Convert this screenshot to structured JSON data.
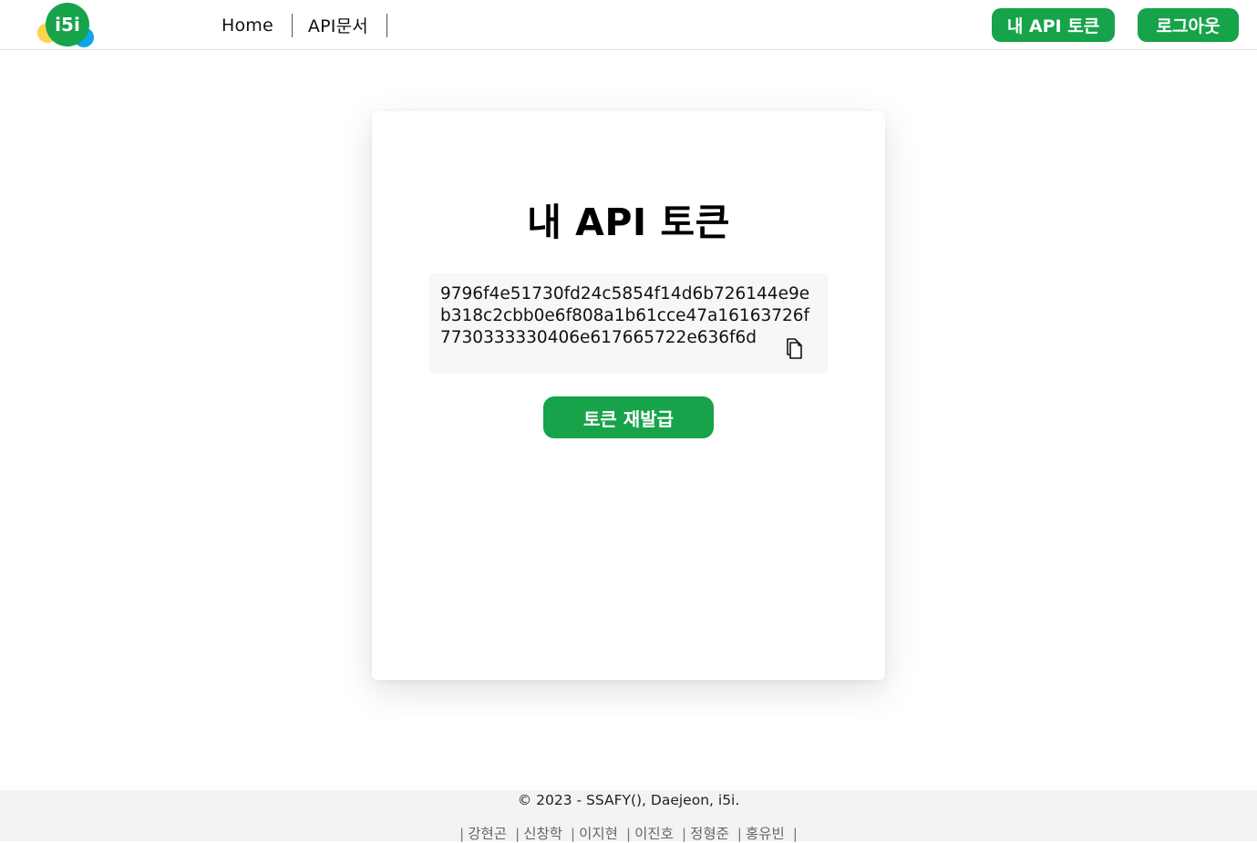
{
  "header": {
    "logo_text": "i5i",
    "nav": [
      {
        "label": "Home"
      },
      {
        "label": "API문서"
      }
    ],
    "token_button_label": "내 API 토큰",
    "logout_button_label": "로그아웃"
  },
  "card": {
    "title": "내 API 토큰",
    "token": "9796f4e51730fd24c5854f14d6b726144e9eb318c2cbb0e6f808a1b61cce47a16163726f7730333330406e617665722e636f6d",
    "reissue_button_label": "토큰 재발급"
  },
  "footer": {
    "copyright": "© 2023 - SSAFY(), Daejeon, i5i.",
    "members": [
      "강현곤",
      "신창학",
      "이지현",
      "이진호",
      "정형준",
      "홍유빈"
    ]
  },
  "colors": {
    "accent": "#16a34a",
    "logo_green": "#16a34a",
    "logo_yellow": "#fcd34d",
    "logo_blue": "#0ea5e9",
    "token_box_bg": "#f7f7f7",
    "footer_bg": "#f3f3f3"
  },
  "icons": {
    "copy": "copy-icon"
  }
}
